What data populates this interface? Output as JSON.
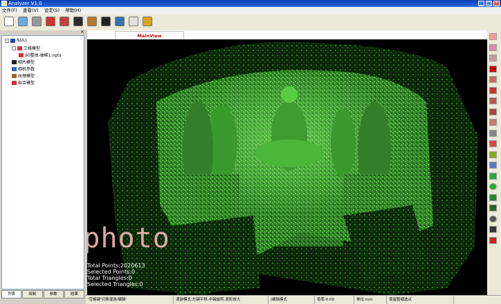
{
  "window": {
    "title": "Analyzer V1.0",
    "buttons": [
      "_",
      "□",
      "×"
    ]
  },
  "menu": [
    "文件(F)",
    "查看(V)",
    "设定(S)",
    "帮助(H)"
  ],
  "toolbar": {
    "buttons": [
      {
        "name": "new-icon",
        "color": "#ffffff"
      },
      {
        "name": "open-icon",
        "color": "#6fa8dc"
      },
      {
        "name": "tool-icon",
        "color": "#999999"
      },
      {
        "name": "measure-icon",
        "color": "#cc3333"
      },
      {
        "name": "paint-icon",
        "color": "#c04040"
      },
      {
        "name": "rotate-icon",
        "color": "#2b2b2b"
      },
      {
        "name": "eye-icon",
        "color": "#b07a30"
      },
      {
        "name": "camera-icon",
        "color": "#222222"
      },
      {
        "name": "save-icon",
        "color": "#3a6fb5"
      },
      {
        "name": "page-icon",
        "color": "#e0e0e0"
      },
      {
        "name": "key-icon",
        "color": "#d9a520"
      }
    ]
  },
  "panel": {
    "close": "×"
  },
  "tree": [
    {
      "label": "NULL",
      "level": 0,
      "expander": "-",
      "icon": "#2244aa"
    },
    {
      "label": "三维模型",
      "level": 1,
      "expander": "-",
      "icon": "#cc3333"
    },
    {
      "label": "90整体-抽稀1.npts",
      "level": 2,
      "expander": "",
      "icon": "#cc3333"
    },
    {
      "label": "相片模型",
      "level": 1,
      "expander": "",
      "icon": "#222222"
    },
    {
      "label": "相机参数",
      "level": 1,
      "expander": "",
      "icon": "#3366cc"
    },
    {
      "label": "纹理模型",
      "level": 1,
      "expander": "",
      "icon": "#996633"
    },
    {
      "label": "拟合模型",
      "level": 1,
      "expander": "",
      "icon": "#cc3333"
    }
  ],
  "tabs": [
    "列表",
    "绘制",
    "参数",
    "结果"
  ],
  "view": {
    "tab": "MainView",
    "stats": [
      "Total Points:2020613",
      "Selected Points:0",
      "Total Triangles:0",
      "Selected Triangles:0"
    ],
    "watermark": "Lensphoto"
  },
  "right_tools": [
    {
      "name": "view-front-icon",
      "color": "#ff9999"
    },
    {
      "name": "view-back-icon",
      "color": "#dd88aa"
    },
    {
      "name": "view-side-icon",
      "color": "#cc9999"
    },
    {
      "name": "delete-icon",
      "color": "#cc0000"
    },
    {
      "name": "select-icon",
      "color": "#cc6666"
    },
    {
      "name": "zoom-icon",
      "color": "#cc3333"
    },
    {
      "name": "grid-icon",
      "color": "#bb5555"
    },
    {
      "name": "mesh-icon",
      "color": "#aa4444"
    },
    {
      "name": "pan-icon",
      "color": "#cc7777"
    },
    {
      "name": "line-icon",
      "color": "#888888"
    },
    {
      "name": "axis-icon",
      "color": "#dd4444"
    },
    {
      "name": "color-icon",
      "color": "#88aa22"
    },
    {
      "name": "split-icon",
      "color": "#5577cc"
    },
    {
      "name": "plane-icon",
      "color": "#22aa44"
    },
    {
      "name": "sphere-icon",
      "color": "#22aa33"
    },
    {
      "name": "cylinder-icon",
      "color": "#228833"
    },
    {
      "name": "cone-icon",
      "color": "#226633"
    },
    {
      "name": "circle-icon",
      "color": "#555555"
    },
    {
      "name": "measure-line-icon",
      "color": "#333333"
    },
    {
      "name": "stop-icon",
      "color": "#cc2222"
    }
  ],
  "status": [
    "'空格键'切换漫游/编辑'",
    "漫游模式:左键平移,中键旋转,滚轮放大",
    "|编辑模式",
    "倍率:0.00",
    "单位:mm",
    "保留暂缩选点"
  ],
  "colors": {
    "points": "#5ee84a",
    "titlebar": "#0a3fb8",
    "background": "#000000"
  }
}
